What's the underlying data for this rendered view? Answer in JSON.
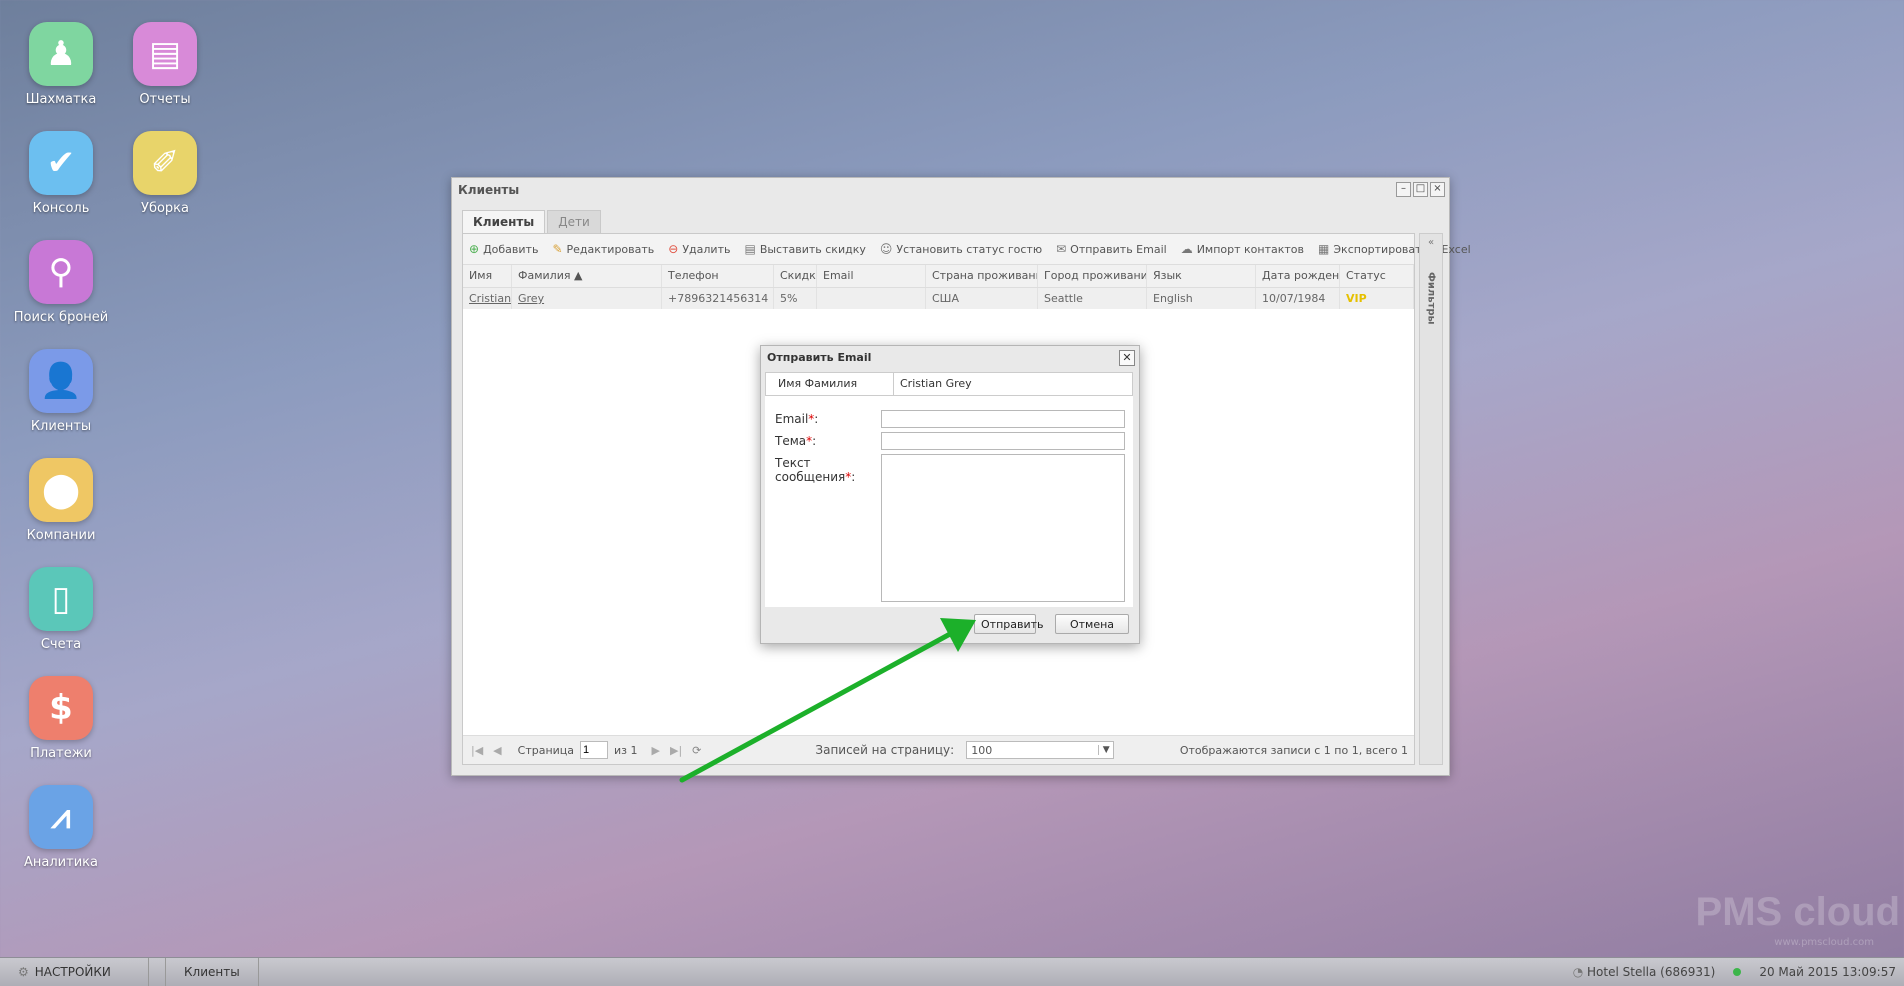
{
  "desktop": {
    "icons": [
      {
        "label": "Шахматка",
        "color": "#7fd6a0",
        "icon": "chess-pawn-icon"
      },
      {
        "label": "Отчеты",
        "color": "#d88ad8",
        "icon": "books-icon"
      },
      {
        "label": "Консоль",
        "color": "#6cbff0",
        "icon": "checkmark-icon"
      },
      {
        "label": "Уборка",
        "color": "#e8d46a",
        "icon": "broom-icon"
      },
      {
        "label": "Поиск броней",
        "color": "#c878d6",
        "icon": "magnifier-icon"
      },
      {
        "label": "Клиенты",
        "color": "#7b9ae8",
        "icon": "person-icon"
      },
      {
        "label": "Компании",
        "color": "#efc764",
        "icon": "map-pin-icon"
      },
      {
        "label": "Счета",
        "color": "#5bc7b9",
        "icon": "document-icon"
      },
      {
        "label": "Платежи",
        "color": "#ee7f6d",
        "icon": "dollar-icon"
      },
      {
        "label": "Аналитика",
        "color": "#6aa3e6",
        "icon": "chart-line-icon"
      }
    ]
  },
  "window": {
    "title": "Клиенты",
    "tabs": [
      "Клиенты",
      "Дети"
    ],
    "toolbar": {
      "add": "Добавить",
      "edit": "Редактировать",
      "delete": "Удалить",
      "discount": "Выставить скидку",
      "status": "Установить статус гостю",
      "send_email": "Отправить Email",
      "import": "Импорт контактов",
      "export": "Экспортировать в Excel"
    },
    "columns": [
      "Имя",
      "Фамилия ▲",
      "Телефон",
      "Скидка",
      "Email",
      "Страна проживания",
      "Город проживания",
      "Язык",
      "Дата рождения",
      "Статус"
    ],
    "rows": [
      [
        "Cristian",
        "Grey",
        "+7896321456314",
        "5%",
        "",
        "США",
        "Seattle",
        "English",
        "10/07/1984",
        "VIP"
      ]
    ],
    "pager": {
      "page_label": "Страница",
      "page_value": "1",
      "of": "из 1",
      "per_page_label": "Записей на страницу:",
      "per_page_value": "100",
      "summary": "Отображаются записи с 1 по 1, всего 1"
    },
    "filters_label": "Фильтры"
  },
  "dialog": {
    "title": "Отправить Email",
    "name_key": "Имя Фамилия",
    "name_value": "Cristian Grey",
    "email_label": "Email",
    "subject_label": "Тема",
    "message_label_1": "Текст",
    "message_label_2": "сообщения",
    "required_mark": "*",
    "colon": ":",
    "send_button": "Отправить",
    "cancel_button": "Отмена"
  },
  "taskbar": {
    "settings": "НАСТРОЙКИ",
    "open_window": "Клиенты",
    "hotel": "Hotel Stella (686931)",
    "datetime": "20 Май 2015 13:09:57"
  },
  "watermark": {
    "brand": "PMS cloud",
    "url": "www.pmscloud.com"
  },
  "colors": {
    "arrow": "#1cb02a",
    "vip": "#e6c000",
    "required": "#dd0000"
  }
}
